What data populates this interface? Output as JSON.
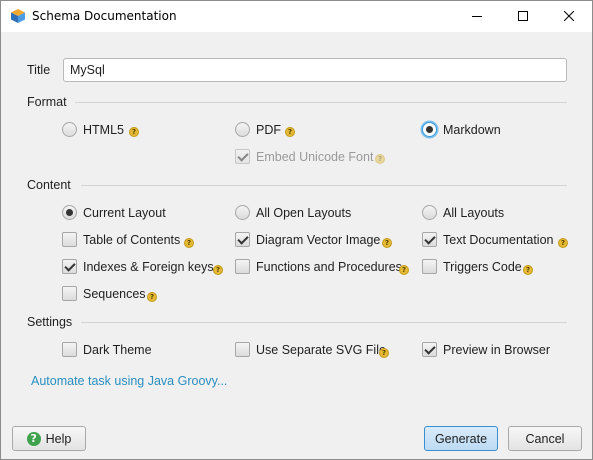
{
  "window": {
    "title": "Schema Documentation",
    "app_icon": "cube-icon",
    "controls": [
      "minimize-icon",
      "maximize-icon",
      "close-icon"
    ]
  },
  "title_field": {
    "label": "Title",
    "value": "MySql"
  },
  "format": {
    "heading": "Format",
    "options": [
      {
        "label": "HTML5",
        "checked": false
      },
      {
        "label": "PDF",
        "checked": false
      },
      {
        "label": "Markdown",
        "checked": true
      }
    ],
    "embed_font": {
      "label": "Embed Unicode Font",
      "checked": true,
      "disabled": true
    }
  },
  "content": {
    "heading": "Content",
    "layouts": [
      {
        "label": "Current Layout",
        "checked": true
      },
      {
        "label": "All Open Layouts",
        "checked": false
      },
      {
        "label": "All Layouts",
        "checked": false
      }
    ],
    "checks": [
      {
        "label": "Table of Contents",
        "checked": false
      },
      {
        "label": "Diagram Vector Image",
        "checked": true
      },
      {
        "label": "Text Documentation",
        "checked": true
      },
      {
        "label": "Indexes & Foreign keys",
        "checked": true
      },
      {
        "label": "Functions and Procedures",
        "checked": false
      },
      {
        "label": "Triggers Code",
        "checked": false
      },
      {
        "label": "Sequences",
        "checked": false
      }
    ]
  },
  "settings": {
    "heading": "Settings",
    "checks": [
      {
        "label": "Dark Theme",
        "checked": false
      },
      {
        "label": "Use Separate SVG File",
        "checked": false
      },
      {
        "label": "Preview in Browser",
        "checked": true
      }
    ]
  },
  "automate_link": "Automate task using Java Groovy...",
  "buttons": {
    "help": "Help",
    "generate": "Generate",
    "cancel": "Cancel"
  },
  "colors": {
    "accent": "#3b9ad9",
    "link": "#2a8fc0",
    "help_hint": "#e4b933"
  }
}
